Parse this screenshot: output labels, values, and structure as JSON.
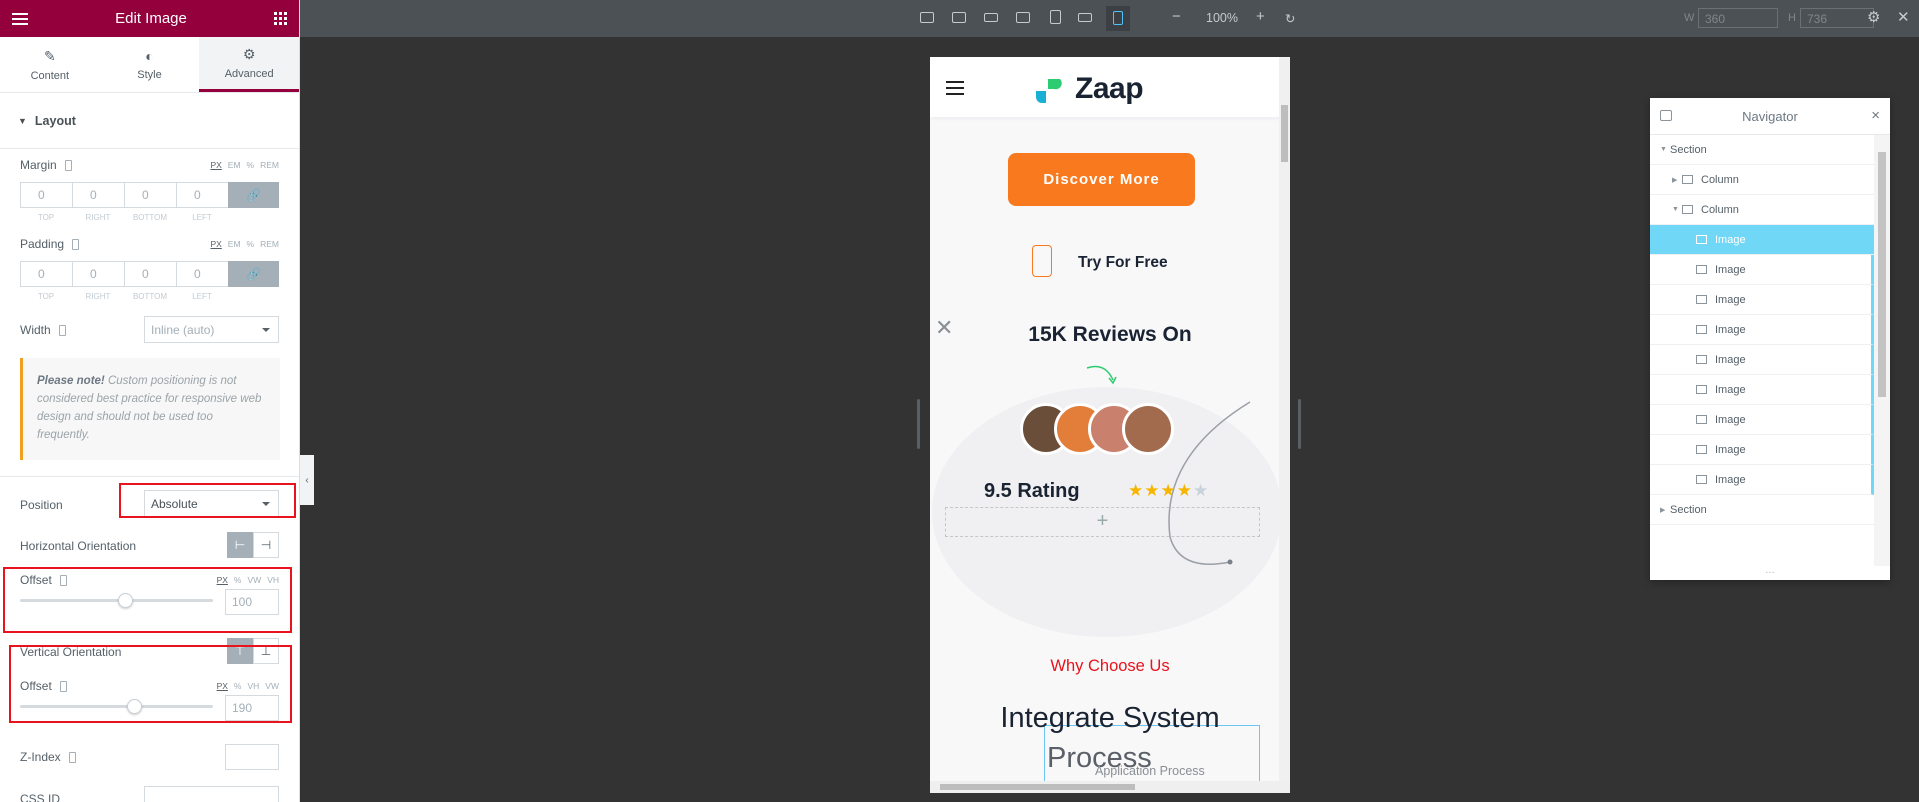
{
  "panel": {
    "title": "Edit Image",
    "tabs": [
      {
        "label": "Content",
        "icon": "pencil-icon"
      },
      {
        "label": "Style",
        "icon": "contrast-icon"
      },
      {
        "label": "Advanced",
        "icon": "gear-icon"
      }
    ],
    "section_title": "Layout",
    "margin": {
      "label": "Margin",
      "units": [
        "PX",
        "EM",
        "%",
        "REM"
      ],
      "values": [
        "0",
        "0",
        "0",
        "0"
      ],
      "sides": [
        "TOP",
        "RIGHT",
        "BOTTOM",
        "LEFT"
      ]
    },
    "padding": {
      "label": "Padding",
      "units": [
        "PX",
        "EM",
        "%",
        "REM"
      ],
      "values": [
        "0",
        "0",
        "0",
        "0"
      ],
      "sides": [
        "TOP",
        "RIGHT",
        "BOTTOM",
        "LEFT"
      ]
    },
    "width": {
      "label": "Width",
      "value": "Inline (auto)"
    },
    "note": {
      "bold": "Please note!",
      "text": " Custom positioning is not considered best practice for responsive web design and should not be used too frequently."
    },
    "position": {
      "label": "Position",
      "value": "Absolute"
    },
    "horizontal_orientation": {
      "label": "Horizontal Orientation"
    },
    "offset_h": {
      "label": "Offset",
      "units": [
        "PX",
        "%",
        "VW",
        "VH"
      ],
      "value": "100",
      "level": 0.55
    },
    "vertical_orientation": {
      "label": "Vertical Orientation"
    },
    "offset_v": {
      "label": "Offset",
      "units": [
        "PX",
        "%",
        "VH",
        "VW"
      ],
      "value": "190",
      "level": 0.6
    },
    "z_index": {
      "label": "Z-Index",
      "value": ""
    },
    "css_id": {
      "label": "CSS ID"
    }
  },
  "toolbar": {
    "zoom": "100%",
    "width_label": "W",
    "width_value": "360",
    "height_label": "H",
    "height_value": "736"
  },
  "site": {
    "logo": "Zaap",
    "cta": "Discover More",
    "try_free": "Try For Free",
    "reviews": "15K Reviews On",
    "rating": "9.5 Rating",
    "stars_filled": 4,
    "stars_total": 5,
    "add_plus": "+",
    "why": "Why Choose Us",
    "integrate": "Integrate System",
    "process": "Process",
    "application_process": "Application Process"
  },
  "navigator": {
    "title": "Navigator",
    "items": [
      {
        "label": "Section"
      },
      {
        "label": "Column"
      },
      {
        "label": "Column"
      },
      {
        "label": "Image"
      },
      {
        "label": "Image"
      },
      {
        "label": "Image"
      },
      {
        "label": "Image"
      },
      {
        "label": "Image"
      },
      {
        "label": "Image"
      },
      {
        "label": "Image"
      },
      {
        "label": "Image"
      },
      {
        "label": "Image"
      },
      {
        "label": "Section"
      }
    ]
  },
  "colors": {
    "brand": "#93003c",
    "accent_orange": "#f97a1e",
    "highlight_red": "#e8131c",
    "selection_blue": "#71d7f7"
  }
}
